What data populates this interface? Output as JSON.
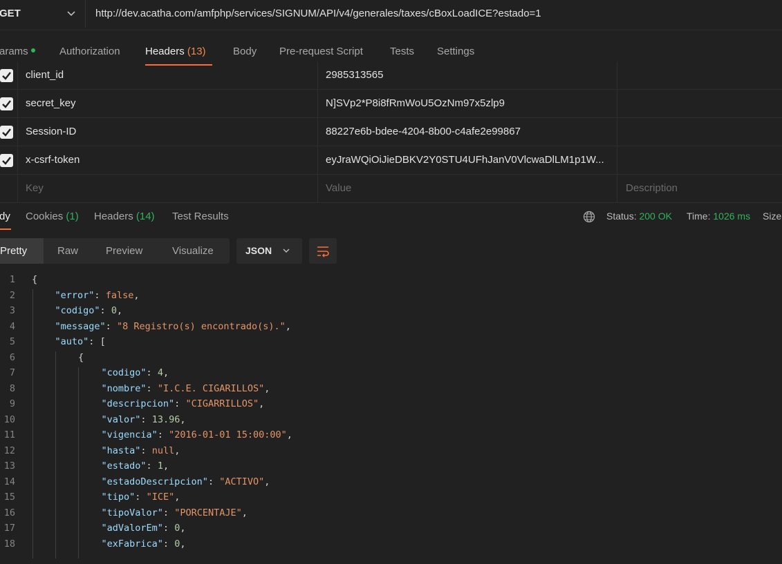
{
  "request": {
    "method": "GET",
    "url": "http://dev.acatha.com/amfphp/services/SIGNUM/API/v4/generales/taxes/cBoxLoadICE?estado=1"
  },
  "request_tabs": [
    {
      "label": "arams",
      "count": ""
    },
    {
      "label": "Authorization",
      "count": ""
    },
    {
      "label": "Headers",
      "count": "(13)"
    },
    {
      "label": "Body",
      "count": ""
    },
    {
      "label": "Pre-request Script",
      "count": ""
    },
    {
      "label": "Tests",
      "count": ""
    },
    {
      "label": "Settings",
      "count": ""
    }
  ],
  "headers_table": {
    "rows": [
      {
        "key": "client_id",
        "value": "2985313565",
        "checked": true
      },
      {
        "key": "secret_key",
        "value": "N]SVp2*P8i8fRmWoU5OzNm97x5zlp9",
        "checked": true
      },
      {
        "key": "Session-ID",
        "value": "88227e6b-bdee-4204-8b00-c4afe2e99867",
        "checked": true
      },
      {
        "key": "x-csrf-token",
        "value": "eyJraWQiOiJieDBKV2Y0STU4UFhJanV0VlcwaDlLM1p1W...",
        "checked": true
      }
    ],
    "placeholder": {
      "key": "Key",
      "value": "Value",
      "description": "Description"
    }
  },
  "response_tabs": [
    {
      "label": "dy",
      "count": ""
    },
    {
      "label": "Cookies",
      "count": "(1)"
    },
    {
      "label": "Headers",
      "count": "(14)"
    },
    {
      "label": "Test Results",
      "count": ""
    }
  ],
  "status": {
    "status_label": "Status:",
    "status_value": "200 OK",
    "time_label": "Time:",
    "time_value": "1026 ms",
    "size_label": "Size"
  },
  "format_toolbar": {
    "modes": [
      "Pretty",
      "Raw",
      "Preview",
      "Visualize"
    ],
    "language": "JSON"
  },
  "code_lines": [
    {
      "n": "1",
      "t": "{"
    },
    {
      "n": "2",
      "t": "\"error\": false,"
    },
    {
      "n": "3",
      "t": "\"codigo\": 0,"
    },
    {
      "n": "4",
      "t": "\"message\": \"8 Registro(s) encontrado(s).\","
    },
    {
      "n": "5",
      "t": "\"auto\": ["
    },
    {
      "n": "6",
      "t": "{"
    },
    {
      "n": "7",
      "t": "\"codigo\": 4,"
    },
    {
      "n": "8",
      "t": "\"nombre\": \"I.C.E. CIGARILLOS\","
    },
    {
      "n": "9",
      "t": "\"descripcion\": \"CIGARRILLOS\","
    },
    {
      "n": "10",
      "t": "\"valor\": 13.96,"
    },
    {
      "n": "11",
      "t": "\"vigencia\": \"2016-01-01 15:00:00\","
    },
    {
      "n": "12",
      "t": "\"hasta\": null,"
    },
    {
      "n": "13",
      "t": "\"estado\": 1,"
    },
    {
      "n": "14",
      "t": "\"estadoDescripcion\": \"ACTIVO\","
    },
    {
      "n": "15",
      "t": "\"tipo\": \"ICE\","
    },
    {
      "n": "16",
      "t": "\"tipoValor\": \"PORCENTAJE\","
    },
    {
      "n": "17",
      "t": "\"adValorEm\": 0,"
    },
    {
      "n": "18",
      "t": "\"exFabrica\": 0,"
    }
  ]
}
